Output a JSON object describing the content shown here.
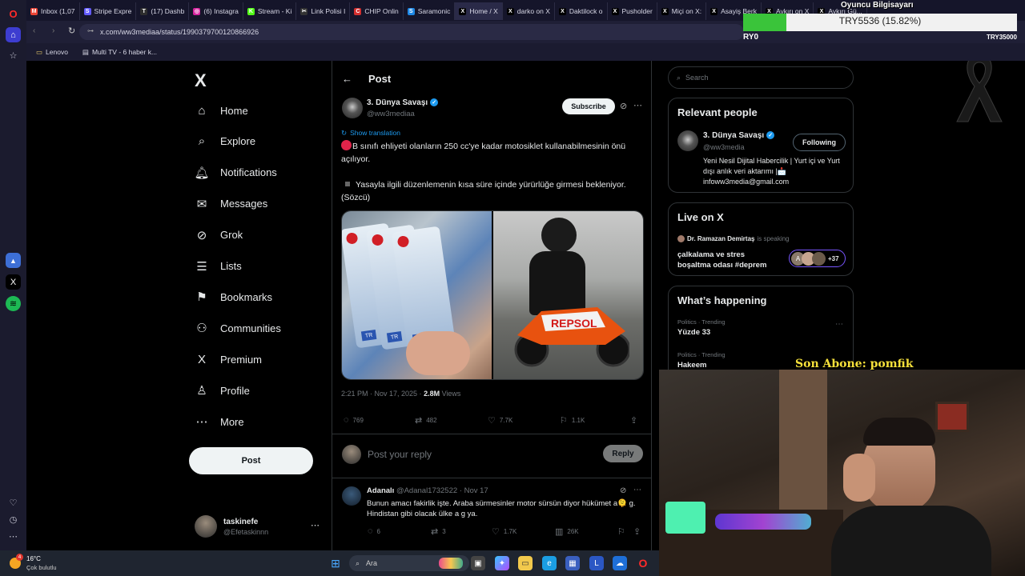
{
  "browser": {
    "tabs": [
      {
        "label": "Inbox (1,07",
        "color": "#ea4335",
        "glyph": "M"
      },
      {
        "label": "Stripe Expre",
        "color": "#635bff",
        "glyph": "S"
      },
      {
        "label": "(17) Dashb",
        "color": "#2d2d2d",
        "glyph": "T"
      },
      {
        "label": "(6) Instagra",
        "color": "#d6249f",
        "glyph": "◎"
      },
      {
        "label": "Stream - Ki",
        "color": "#53fc18",
        "glyph": "K"
      },
      {
        "label": "Link Polisi I",
        "color": "#333333",
        "glyph": "✂"
      },
      {
        "label": "CHIP Onlin",
        "color": "#d32f2f",
        "glyph": "C"
      },
      {
        "label": "Saramonic",
        "color": "#1e88e5",
        "glyph": "S"
      },
      {
        "label": "Home / X",
        "color": "#000000",
        "glyph": "X",
        "active": true
      },
      {
        "label": "darko on X",
        "color": "#000000",
        "glyph": "X"
      },
      {
        "label": "Daktilock o",
        "color": "#000000",
        "glyph": "X"
      },
      {
        "label": "Pusholder",
        "color": "#000000",
        "glyph": "X"
      },
      {
        "label": "Miçi on X:",
        "color": "#000000",
        "glyph": "X"
      },
      {
        "label": "Asayiş Berk",
        "color": "#000000",
        "glyph": "X"
      },
      {
        "label": "Aykırı on X",
        "color": "#000000",
        "glyph": "X"
      },
      {
        "label": "Aykırı Gü...",
        "color": "#000000",
        "glyph": "X"
      }
    ],
    "url": "x.com/ww3mediaa/status/1990379700120866926",
    "bookmarks": [
      "Lenovo",
      "Multi TV - 6 haber k..."
    ]
  },
  "nav": {
    "logo": "X",
    "items": [
      {
        "label": "Home",
        "icon": "⌂"
      },
      {
        "label": "Explore",
        "icon": "⌕"
      },
      {
        "label": "Notifications",
        "icon": "🔔︎"
      },
      {
        "label": "Messages",
        "icon": "✉"
      },
      {
        "label": "Grok",
        "icon": "⊘"
      },
      {
        "label": "Lists",
        "icon": "☰"
      },
      {
        "label": "Bookmarks",
        "icon": "⚑"
      },
      {
        "label": "Communities",
        "icon": "⚇"
      },
      {
        "label": "Premium",
        "icon": "X"
      },
      {
        "label": "Profile",
        "icon": "♙"
      },
      {
        "label": "More",
        "icon": "⋯"
      }
    ],
    "post_label": "Post",
    "account": {
      "name": "taskinefe",
      "handle": "@Efetaskinnn"
    }
  },
  "post": {
    "header_title": "Post",
    "author_name": "3. Dünya Savaşı",
    "author_handle": "@ww3mediaa",
    "subscribe_label": "Subscribe",
    "show_translation": "Show translation",
    "text_line1": "B sınıfı ehliyeti olanların 250 cc'ye kadar motosiklet kullanabilmesinin önü açılıyor.",
    "text_line2": "Yasayla ilgili düzenlemenin kısa süre içinde yürürlüğe girmesi bekleniyor. (Sözcü)",
    "timestamp": "2:21 PM · Nov 17, 2025 · ",
    "views_count": "2.8M",
    "views_label": " Views",
    "stats": {
      "replies": "769",
      "reposts": "482",
      "likes": "7.7K",
      "bookmarks": "1.1K"
    },
    "reply_placeholder": "Post your reply",
    "reply_button": "Reply",
    "card_label": "TR",
    "bike_text": "REPSOL"
  },
  "reply": {
    "name": "Adanalı",
    "handle": "@Adanal1732522 · Nov 17",
    "text": "Bunun amacı fakirlik işte. Araba sürmesinler motor sürsün diyor hükümet a🫠 g. Hindistan gibi olacak ülke a g ya.",
    "stats": {
      "replies": "6",
      "reposts": "3",
      "likes": "1.7K",
      "views": "26K"
    }
  },
  "right": {
    "search_placeholder": "Search",
    "relevant_title": "Relevant people",
    "relevant_name": "3. Dünya Savaşı",
    "relevant_handle": "@ww3media",
    "following_label": "Following",
    "bio": "Yeni Nesil Dijital Habercilik | Yurt içi ve Yurt dışı anlık veri aktarımı |📩 infoww3media@gmail.com",
    "live_title": "Live on X",
    "live_host": "Dr. Ramazan Demirtaş",
    "live_speaking": " is speaking",
    "live_topic": "çalkalama ve stres boşaltma odası #deprem",
    "live_count": "+37",
    "live_avatar_letter": "A",
    "happening_title": "What’s happening",
    "trends": [
      {
        "category": "Politics · Trending",
        "name": "Yüzde 33"
      },
      {
        "category": "Politics · Trending",
        "name": "Hakeem"
      }
    ]
  },
  "overlay": {
    "son_abone": "Son Abone: pomfik",
    "donation_title": "Oyuncu Bilgisayarı",
    "donation_amount": "TRY5536 (15.82%)",
    "donation_fraction": 0.1582,
    "donation_start": "RY0",
    "donation_goal": "TRY35000"
  },
  "taskbar": {
    "weather_temp": "16°C",
    "weather_desc": "Çok bulutlu",
    "weather_badge": "4",
    "search_placeholder": "Ara"
  }
}
